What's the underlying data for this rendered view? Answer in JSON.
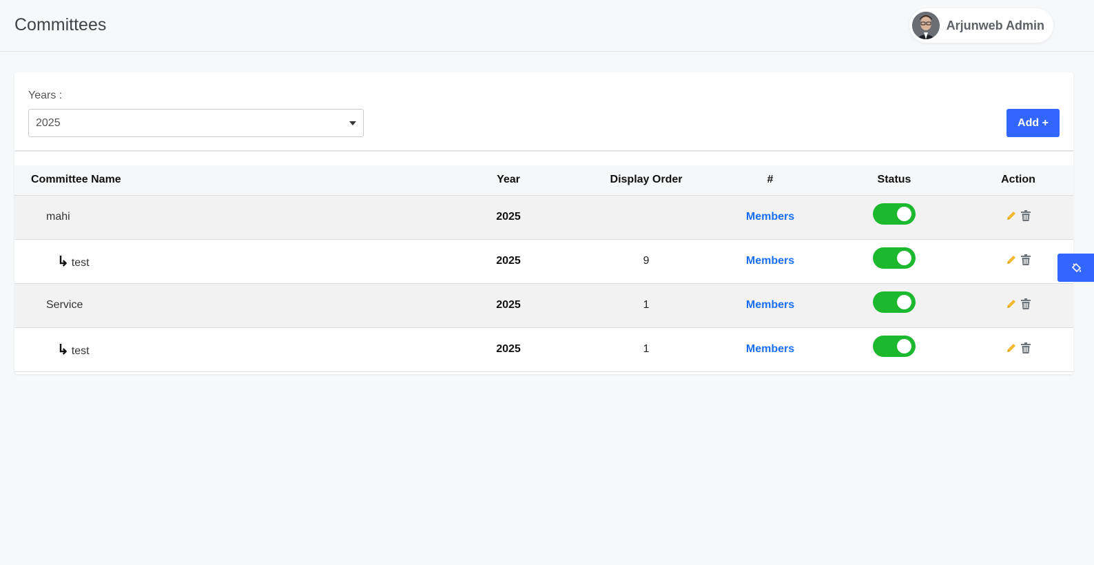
{
  "header": {
    "title": "Committees",
    "user_name": "Arjunweb Admin"
  },
  "filter": {
    "label": "Years :",
    "selected_year": "2025",
    "add_label": "Add +"
  },
  "table": {
    "columns": {
      "name": "Committee Name",
      "year": "Year",
      "order": "Display Order",
      "hash": "#",
      "status": "Status",
      "action": "Action"
    },
    "rows": [
      {
        "name": "mahi",
        "child": false,
        "year": "2025",
        "order": "",
        "link": "Members",
        "status": "on"
      },
      {
        "name": "test",
        "child": true,
        "year": "2025",
        "order": "9",
        "link": "Members",
        "status": "on"
      },
      {
        "name": "Service",
        "child": false,
        "year": "2025",
        "order": "1",
        "link": "Members",
        "status": "on"
      },
      {
        "name": "test",
        "child": true,
        "year": "2025",
        "order": "1",
        "link": "Members",
        "status": "on"
      }
    ],
    "child_arrow": "↳"
  },
  "colors": {
    "primary": "#3366ff",
    "toggle_on": "#1cb82e",
    "link": "#1a6ef5",
    "edit_icon": "#f5b82e",
    "delete_icon": "#6c757d"
  },
  "icons": {
    "edit": "pencil-icon",
    "delete": "trash-icon",
    "floating": "paint-bucket-icon"
  }
}
